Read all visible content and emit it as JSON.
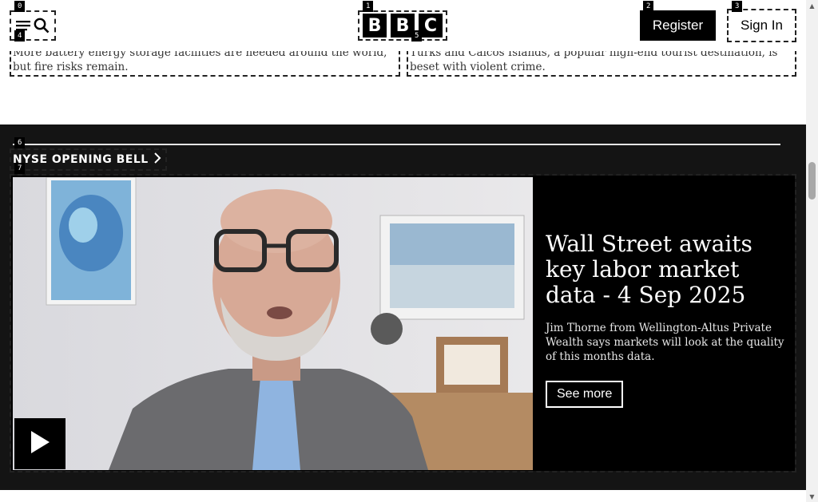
{
  "header": {
    "logo_letters": [
      "B",
      "B",
      "C"
    ],
    "register_label": "Register",
    "signin_label": "Sign In",
    "menu_icon": "hamburger-menu-icon",
    "search_icon": "search-icon"
  },
  "snippets": {
    "left": "More battery energy storage facilities are needed around the world, but fire risks remain.",
    "right": "Turks and Caicos Islands, a popular high-end tourist destination, is beset with violent crime."
  },
  "section": {
    "title": "NYSE OPENING BELL",
    "chevron_icon": "chevron-right-icon"
  },
  "card": {
    "headline": "Wall Street awaits key labor market data - 4 Sep 2025",
    "summary": "Jim Thorne from Wellington-Altus Private Wealth says markets will look at the quality of this months data.",
    "cta_label": "See more",
    "play_icon": "play-icon"
  },
  "annotations": [
    "0",
    "1",
    "2",
    "3",
    "4",
    "5",
    "6",
    "7"
  ],
  "colors": {
    "dark_bg": "#141414",
    "card_bg": "#000000",
    "text_light": "#ffffff"
  }
}
